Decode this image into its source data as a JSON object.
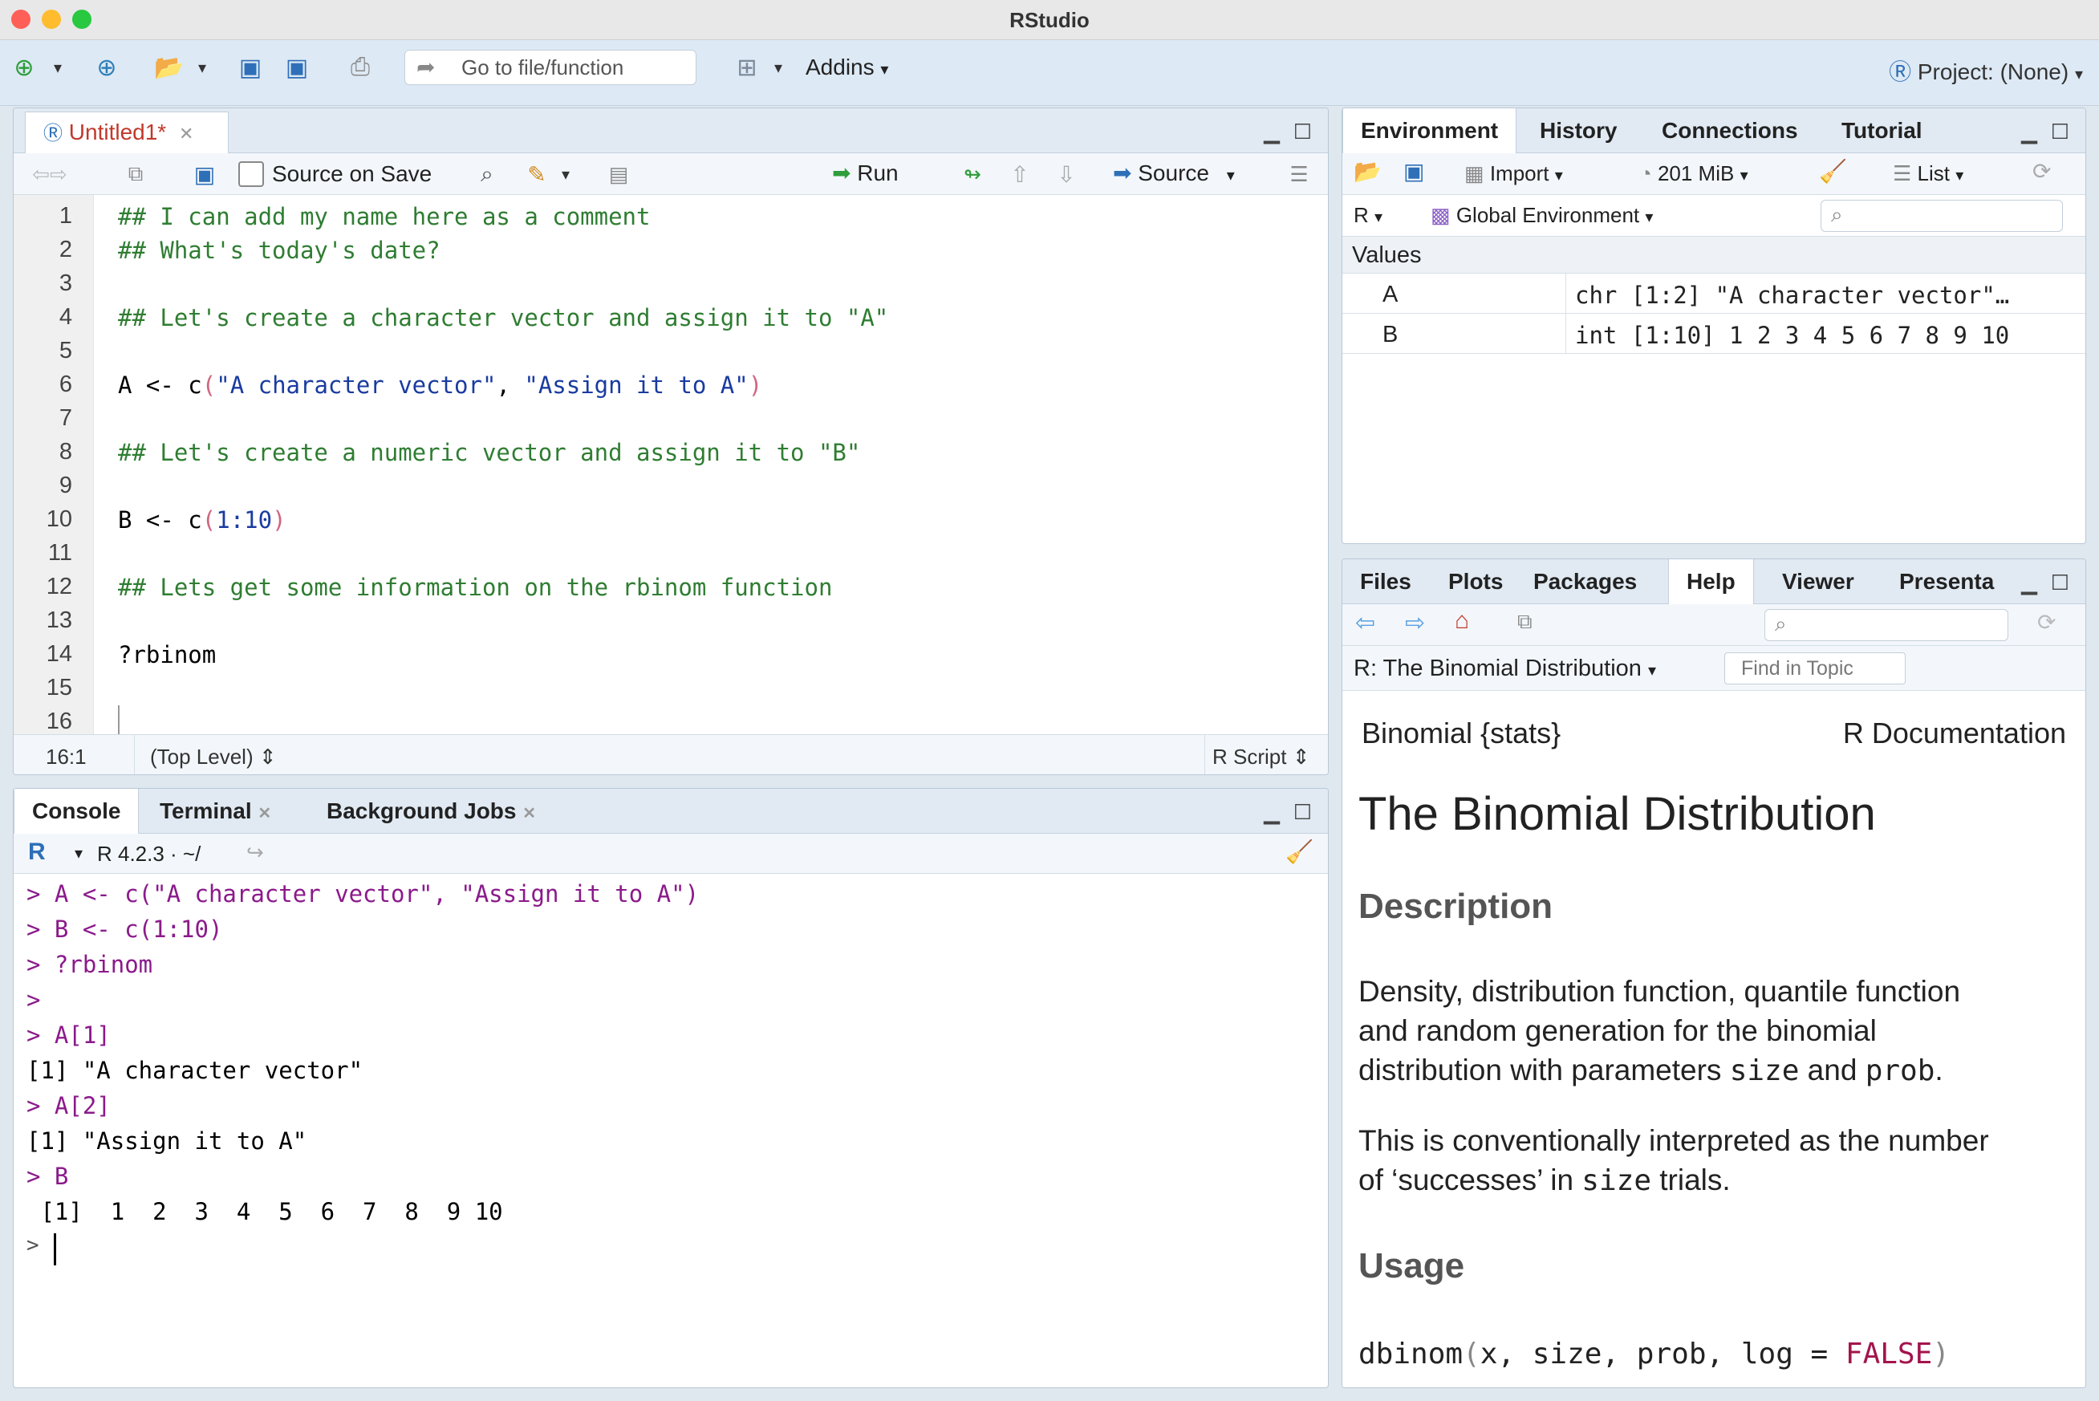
{
  "app": {
    "title": "RStudio"
  },
  "toolbar": {
    "goto_placeholder": "Go to file/function",
    "addins_label": "Addins",
    "project_label": "Project: (None)"
  },
  "editor": {
    "tab_label": "Untitled1*",
    "source_on_save_label": "Source on Save",
    "run_label": "Run",
    "source_label": "Source",
    "lines": [
      "1",
      "2",
      "3",
      "4",
      "5",
      "6",
      "7",
      "8",
      "9",
      "10",
      "11",
      "12",
      "13",
      "14",
      "15",
      "16"
    ],
    "code": {
      "l1": "## I can add my name here as a comment",
      "l2": "## What's today's date?",
      "l4": "## Let's create a character vector and assign it to \"A\"",
      "l6a": "A <- c",
      "l6b": "(",
      "l6c": "\"A character vector\"",
      "l6d": ", ",
      "l6e": "\"Assign it to A\"",
      "l6f": ")",
      "l8": "## Let's create a numeric vector and assign it to \"B\"",
      "l10a": "B <- c",
      "l10b": "(",
      "l10c": "1:10",
      "l10d": ")",
      "l12": "## Lets get some information on the rbinom function",
      "l14": "?rbinom"
    },
    "status": {
      "position": "16:1",
      "scope": "(Top Level)",
      "filetype": "R Script"
    }
  },
  "console": {
    "tabs": [
      "Console",
      "Terminal",
      "Background Jobs"
    ],
    "version": "R 4.2.3 · ~/",
    "lines": {
      "c1": "> A <- c(\"A character vector\", \"Assign it to A\")",
      "c2": "> B <- c(1:10)",
      "c3": "> ?rbinom",
      "c4": ">",
      "c5": "> A[1]",
      "c6": "[1] \"A character vector\"",
      "c7": "> A[2]",
      "c8": "[1] \"Assign it to A\"",
      "c9": "> B",
      "c10": " [1]  1  2  3  4  5  6  7  8  9 10",
      "c11": ">"
    }
  },
  "environment": {
    "tabs": [
      "Environment",
      "History",
      "Connections",
      "Tutorial"
    ],
    "import_label": "Import",
    "memory_label": "201 MiB",
    "list_label": "List",
    "lang_label": "R",
    "scope_label": "Global Environment",
    "values_header": "Values",
    "rows": [
      {
        "name": "A",
        "value": "chr [1:2] \"A character vector\"…"
      },
      {
        "name": "B",
        "value": "int [1:10] 1 2 3 4 5 6 7 8 9 10"
      }
    ]
  },
  "help": {
    "tabs": [
      "Files",
      "Plots",
      "Packages",
      "Help",
      "Viewer",
      "Presenta"
    ],
    "topic_label": "R: The Binomial Distribution",
    "find_placeholder": "Find in Topic",
    "doc_left": "Binomial {stats}",
    "doc_right": "R Documentation",
    "heading": "The Binomial Distribution",
    "description_heading": "Description",
    "desc_p1_a": "Density, distribution function, quantile function",
    "desc_p1_b": "and random generation for the binomial",
    "desc_p1_c1": "distribution with parameters ",
    "desc_p1_c2": "size",
    "desc_p1_c3": " and ",
    "desc_p1_c4": "prob",
    "desc_p1_c5": ".",
    "desc_p2_a": "This is conventionally interpreted as the number",
    "desc_p2_b1": "of ‘successes’ in ",
    "desc_p2_b2": "size",
    "desc_p2_b3": " trials.",
    "usage_heading": "Usage",
    "usage_a": "dbinom",
    "usage_b": "(",
    "usage_c": "x, size, prob, log = ",
    "usage_d": "FALSE",
    "usage_e": ")"
  }
}
